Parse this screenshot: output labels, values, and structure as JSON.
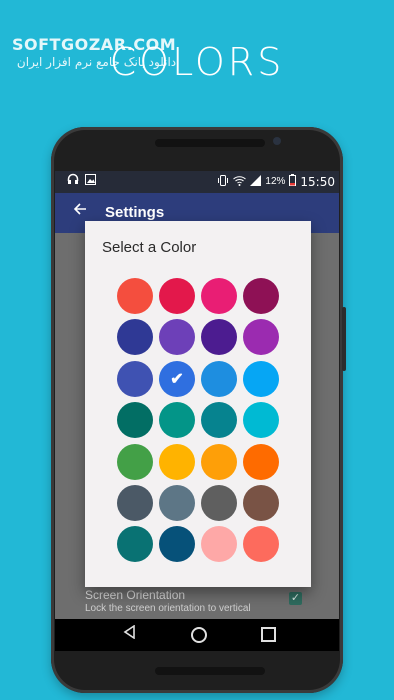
{
  "watermark": {
    "latin": "SOFTGOZAR.COM",
    "persian": "دانلود بانک جامع نرم افزار ایران"
  },
  "headline": "COLORS",
  "status_bar": {
    "left_icons": [
      "headphones-icon",
      "image-icon"
    ],
    "right_icons": [
      "vibrate-icon",
      "wifi-icon",
      "signal-icon",
      "battery-icon"
    ],
    "battery_percent": "12%",
    "time": "15:50"
  },
  "app_bar": {
    "title": "Settings",
    "back_icon": "arrow-back-icon"
  },
  "settings": {
    "screen_orientation_title": "Screen Orientation",
    "screen_orientation_subtitle": "Lock the screen orientation to vertical",
    "screen_orientation_checked": true
  },
  "dialog": {
    "title": "Select a Color",
    "selected_index": 9,
    "colors": [
      "#f44e3e",
      "#e3184b",
      "#e91e74",
      "#8e1155",
      "#2f3995",
      "#6d40b8",
      "#4c1c90",
      "#9b2bb0",
      "#3f52b2",
      "#2f6fe0",
      "#1e8ee0",
      "#06a6f4",
      "#026e64",
      "#039588",
      "#06838f",
      "#00bad3",
      "#43a047",
      "#ffb300",
      "#fe9f08",
      "#fe6b00",
      "#4b5966",
      "#5d7686",
      "#5f5f5f",
      "#795345",
      "#097273",
      "#065179",
      "#fea8a7",
      "#fd6b5d"
    ]
  },
  "nav_bar": {
    "back_icon": "nav-back-icon",
    "home_icon": "nav-home-icon",
    "recents_icon": "nav-recents-icon"
  }
}
